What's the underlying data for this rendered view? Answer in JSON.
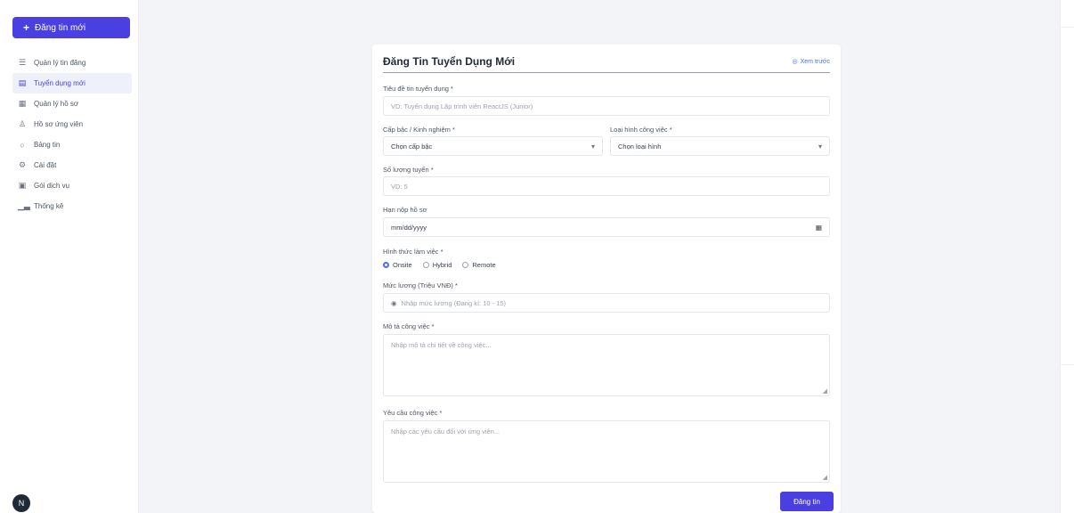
{
  "sidebar": {
    "new_button": {
      "icon": "plus-icon",
      "label": "Đăng tin mới"
    },
    "items": [
      {
        "label": "Quản lý tin đăng",
        "icon": "list-icon",
        "active": false
      },
      {
        "label": "Tuyển dụng mới",
        "icon": "document-icon",
        "active": true
      },
      {
        "label": "Quản lý hồ sơ",
        "icon": "folder-icon",
        "active": false
      },
      {
        "label": "Hồ sơ ứng viên",
        "icon": "user-icon",
        "active": false
      },
      {
        "label": "Bảng tin",
        "icon": "chat-icon",
        "active": false
      },
      {
        "label": "Cài đặt",
        "icon": "gear-icon",
        "active": false
      },
      {
        "label": "Gói dịch vụ",
        "icon": "calendar-icon",
        "active": false
      },
      {
        "label": "Thống kê",
        "icon": "chart-icon",
        "active": false
      }
    ],
    "avatar_initial": "N"
  },
  "form": {
    "title": "Đăng Tin Tuyển Dụng Mới",
    "header_link": "Xem trước",
    "job_title": {
      "label": "Tiêu đề tin tuyển dụng *",
      "placeholder": "VD: Tuyển dụng Lập trình viên ReactJS (Junior)"
    },
    "level": {
      "label": "Cấp bậc / Kinh nghiệm *",
      "value": "Chọn cấp bậc"
    },
    "job_type": {
      "label": "Loại hình công việc *",
      "value": "Chọn loại hình"
    },
    "quantity": {
      "label": "Số lượng tuyển *",
      "placeholder": "VD: 5"
    },
    "deadline": {
      "label": "Hạn nộp hồ sơ",
      "value": "mm/dd/yyyy"
    },
    "work_mode": {
      "label": "Hình thức làm việc *",
      "options": [
        {
          "label": "Onsite",
          "selected": true
        },
        {
          "label": "Hybrid",
          "selected": false
        },
        {
          "label": "Remote",
          "selected": false
        }
      ]
    },
    "salary": {
      "label": "Mức lương (Triệu VNĐ) *",
      "placeholder": "Nhập mức lương (Đang kí: 10 - 15)"
    },
    "description": {
      "label": "Mô tả công việc *",
      "placeholder": "Nhập mô tả chi tiết về công việc..."
    },
    "requirements": {
      "label": "Yêu cầu công việc *",
      "placeholder": "Nhập các yêu cầu đối với ứng viên..."
    },
    "submit_label": "Đăng tin"
  },
  "colors": {
    "accent": "#4a3fe0",
    "link": "#4a6cf7"
  }
}
